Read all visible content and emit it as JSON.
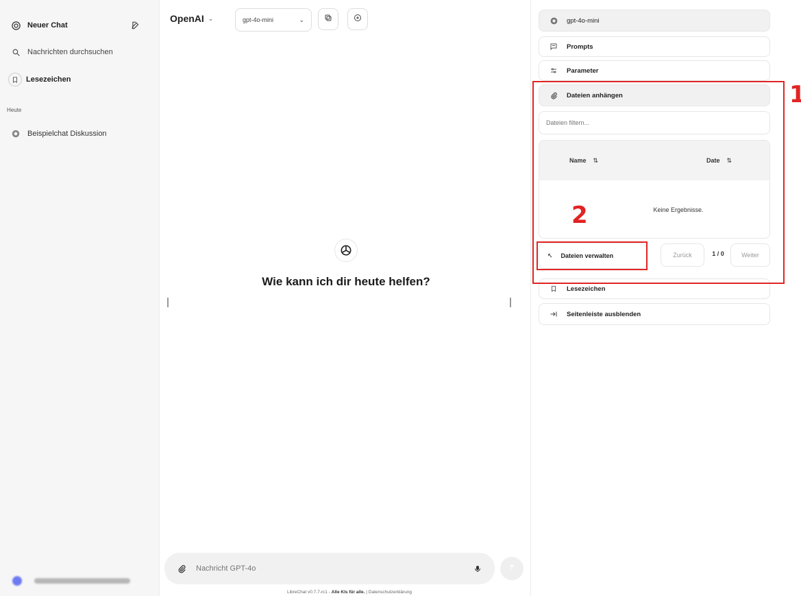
{
  "sidebar": {
    "new_chat": "Neuer Chat",
    "search": "Nachrichten durchsuchen",
    "bookmarks": "Lesezeichen",
    "section_today": "Heute",
    "conversation": "Beispielchat Diskussion"
  },
  "header": {
    "provider": "OpenAI",
    "model": "gpt-4o-mini"
  },
  "main": {
    "greeting": "Wie kann ich dir heute helfen?",
    "composer_placeholder": "Nachricht GPT-4o",
    "footer_version": "LibreChat v0.7.7-rc1 -",
    "footer_slogan": "Alle KIs für alle.",
    "footer_sep": "|",
    "footer_privacy": "Datenschutzerklärung"
  },
  "right_panel": {
    "model": "gpt-4o-mini",
    "prompts": "Prompts",
    "parameters": "Parameter",
    "attach_files": "Dateien anhängen",
    "filter_placeholder": "Dateien filtern...",
    "col_name": "Name",
    "col_date": "Date",
    "sort_glyph": "⇅",
    "empty": "Keine Ergebnisse.",
    "manage_files": "Dateien verwalten",
    "prev": "Zurück",
    "page_info": "1 / 0",
    "next": "Weiter",
    "bookmarks": "Lesezeichen",
    "hide_sidebar": "Seitenleiste ausblenden"
  },
  "annotations": {
    "label_1": "1",
    "label_2": "2",
    "color": "#e02424"
  }
}
